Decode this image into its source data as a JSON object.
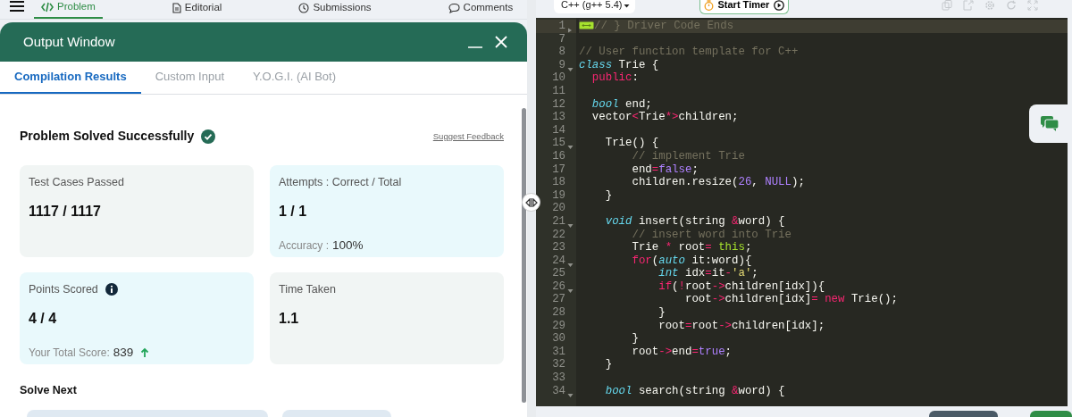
{
  "nav": {
    "tabs": [
      {
        "label": "Problem",
        "selected": true
      },
      {
        "label": "Editorial",
        "selected": false
      },
      {
        "label": "Submissions",
        "selected": false
      },
      {
        "label": "Comments",
        "selected": false
      }
    ]
  },
  "output_window": {
    "title": "Output Window",
    "tabs": [
      {
        "label": "Compilation Results",
        "selected": true
      },
      {
        "label": "Custom Input",
        "selected": false
      },
      {
        "label": "Y.O.G.I. (AI Bot)",
        "selected": false
      }
    ],
    "status": "Problem Solved Successfully",
    "feedback_link": "Suggest Feedback",
    "stats": [
      {
        "label": "Test Cases Passed",
        "value": "1117 / 1117",
        "color": "#f1f5f4"
      },
      {
        "label": "Attempts : Correct / Total",
        "value": "1 / 1",
        "note_label": "Accuracy :",
        "note_value": "100%",
        "color": "#e9f9fc"
      },
      {
        "label": "Points Scored",
        "info": true,
        "value": "4 / 4",
        "note_label": "Your Total Score:",
        "note_value": "839",
        "rising": true,
        "color": "#e9f9fc"
      },
      {
        "label": "Time Taken",
        "value": "1.1",
        "color": "#f1f5f4"
      }
    ],
    "solve_next": {
      "title": "Solve Next"
    }
  },
  "editor": {
    "language": "C++ (g++ 5.4)",
    "timer_button": "Start Timer",
    "lines": [
      {
        "number": "1",
        "folded": true,
        "active": true,
        "tokens": [
          {
            "kind": "comment",
            "text": "// } Driver Code Ends"
          }
        ]
      },
      {
        "number": "7"
      },
      {
        "number": "8",
        "tokens": [
          {
            "kind": "comment",
            "text": "// User function template for C++"
          }
        ]
      },
      {
        "number": "9",
        "folded": false,
        "tokens": [
          {
            "kind": "type",
            "text": "class"
          },
          {
            "kind": "plain",
            "text": " Trie {"
          }
        ]
      },
      {
        "number": "10",
        "tokens": [
          {
            "kind": "keyword",
            "text": "  public"
          },
          {
            "kind": "plain",
            "text": ":"
          }
        ]
      },
      {
        "number": "11"
      },
      {
        "number": "12",
        "tokens": [
          {
            "kind": "type",
            "text": "  bool"
          },
          {
            "kind": "plain",
            "text": " end;"
          }
        ]
      },
      {
        "number": "13",
        "tokens": [
          {
            "kind": "plain",
            "text": "  vector"
          },
          {
            "kind": "keyword",
            "text": "<"
          },
          {
            "kind": "plain",
            "text": "Trie"
          },
          {
            "kind": "keyword",
            "text": "*>"
          },
          {
            "kind": "plain",
            "text": "children;"
          }
        ]
      },
      {
        "number": "14"
      },
      {
        "number": "15",
        "folded": false,
        "tokens": [
          {
            "kind": "plain",
            "text": "    Trie() {"
          }
        ]
      },
      {
        "number": "16",
        "tokens": [
          {
            "kind": "comment",
            "text": "        // implement Trie"
          }
        ]
      },
      {
        "number": "17",
        "tokens": [
          {
            "kind": "plain",
            "text": "        end"
          },
          {
            "kind": "keyword",
            "text": "="
          },
          {
            "kind": "constant",
            "text": "false"
          },
          {
            "kind": "plain",
            "text": ";"
          }
        ]
      },
      {
        "number": "18",
        "tokens": [
          {
            "kind": "plain",
            "text": "        children.resize("
          },
          {
            "kind": "constant",
            "text": "26"
          },
          {
            "kind": "plain",
            "text": ", "
          },
          {
            "kind": "constant",
            "text": "NULL"
          },
          {
            "kind": "plain",
            "text": ");"
          }
        ]
      },
      {
        "number": "19",
        "tokens": [
          {
            "kind": "plain",
            "text": "    }"
          }
        ]
      },
      {
        "number": "20"
      },
      {
        "number": "21",
        "folded": false,
        "tokens": [
          {
            "kind": "type",
            "text": "    void"
          },
          {
            "kind": "plain",
            "text": " insert(string "
          },
          {
            "kind": "keyword",
            "text": "&"
          },
          {
            "kind": "plain",
            "text": "word) {"
          }
        ]
      },
      {
        "number": "22",
        "tokens": [
          {
            "kind": "comment",
            "text": "        // insert word into Trie"
          }
        ]
      },
      {
        "number": "23",
        "tokens": [
          {
            "kind": "plain",
            "text": "        Trie "
          },
          {
            "kind": "keyword",
            "text": "*"
          },
          {
            "kind": "plain",
            "text": " root"
          },
          {
            "kind": "keyword",
            "text": "="
          },
          {
            "kind": "builtin",
            "text": " this"
          },
          {
            "kind": "plain",
            "text": ";"
          }
        ]
      },
      {
        "number": "24",
        "folded": false,
        "tokens": [
          {
            "kind": "keyword",
            "text": "        for"
          },
          {
            "kind": "plain",
            "text": "("
          },
          {
            "kind": "type",
            "text": "auto"
          },
          {
            "kind": "plain",
            "text": " it:word){"
          }
        ]
      },
      {
        "number": "25",
        "tokens": [
          {
            "kind": "type",
            "text": "            int"
          },
          {
            "kind": "plain",
            "text": " idx"
          },
          {
            "kind": "keyword",
            "text": "="
          },
          {
            "kind": "plain",
            "text": "it"
          },
          {
            "kind": "keyword",
            "text": "-"
          },
          {
            "kind": "string",
            "text": "'a'"
          },
          {
            "kind": "plain",
            "text": ";"
          }
        ]
      },
      {
        "number": "26",
        "folded": false,
        "tokens": [
          {
            "kind": "keyword",
            "text": "            if"
          },
          {
            "kind": "plain",
            "text": "("
          },
          {
            "kind": "keyword",
            "text": "!"
          },
          {
            "kind": "plain",
            "text": "root"
          },
          {
            "kind": "keyword",
            "text": "->"
          },
          {
            "kind": "plain",
            "text": "children[idx]){"
          }
        ]
      },
      {
        "number": "27",
        "tokens": [
          {
            "kind": "plain",
            "text": "                root"
          },
          {
            "kind": "keyword",
            "text": "->"
          },
          {
            "kind": "plain",
            "text": "children[idx]"
          },
          {
            "kind": "keyword",
            "text": "="
          },
          {
            "kind": "keyword",
            "text": " new"
          },
          {
            "kind": "plain",
            "text": " Trie();"
          }
        ]
      },
      {
        "number": "28",
        "tokens": [
          {
            "kind": "plain",
            "text": "            }"
          }
        ]
      },
      {
        "number": "29",
        "tokens": [
          {
            "kind": "plain",
            "text": "            root"
          },
          {
            "kind": "keyword",
            "text": "="
          },
          {
            "kind": "plain",
            "text": "root"
          },
          {
            "kind": "keyword",
            "text": "->"
          },
          {
            "kind": "plain",
            "text": "children[idx];"
          }
        ]
      },
      {
        "number": "30",
        "tokens": [
          {
            "kind": "plain",
            "text": "        }"
          }
        ]
      },
      {
        "number": "31",
        "tokens": [
          {
            "kind": "plain",
            "text": "        root"
          },
          {
            "kind": "keyword",
            "text": "->"
          },
          {
            "kind": "plain",
            "text": "end"
          },
          {
            "kind": "keyword",
            "text": "="
          },
          {
            "kind": "constant",
            "text": "true"
          },
          {
            "kind": "plain",
            "text": ";"
          }
        ]
      },
      {
        "number": "32",
        "tokens": [
          {
            "kind": "plain",
            "text": "    }"
          }
        ]
      },
      {
        "number": "33"
      },
      {
        "number": "34",
        "folded": false,
        "tokens": [
          {
            "kind": "type",
            "text": "    bool"
          },
          {
            "kind": "plain",
            "text": " search(string "
          },
          {
            "kind": "keyword",
            "text": "&"
          },
          {
            "kind": "plain",
            "text": "word) {"
          }
        ]
      }
    ]
  }
}
